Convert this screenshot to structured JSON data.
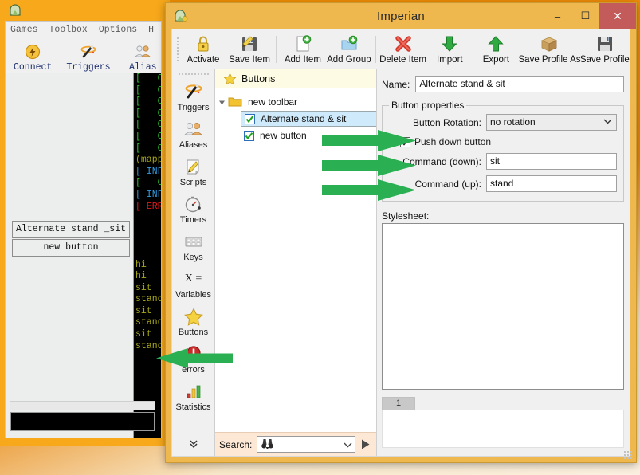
{
  "background_window": {
    "title": "",
    "icon": "mud-client-icon",
    "menu": [
      "Games",
      "Toolbox",
      "Options",
      "H"
    ],
    "toolbar": [
      {
        "label": "Connect",
        "icon": "lightning-bolt-icon"
      },
      {
        "label": "Triggers",
        "icon": "magic-wand-icon"
      },
      {
        "label": "Alias",
        "icon": "people-icon"
      }
    ],
    "buttons_panel": [
      {
        "label": "Alternate stand _sit"
      },
      {
        "label": "new button"
      }
    ],
    "terminal_lines": [
      {
        "text": "[   OK",
        "color": "green"
      },
      {
        "text": "[   OK",
        "color": "green"
      },
      {
        "text": "[   OK",
        "color": "green"
      },
      {
        "text": "[   OK",
        "color": "green"
      },
      {
        "text": "[   OK",
        "color": "green"
      },
      {
        "text": "[   OK",
        "color": "green"
      },
      {
        "text": "[   OK",
        "color": "green"
      },
      {
        "text": "(mappe",
        "color": "olive"
      },
      {
        "text": "[ INFO",
        "color": "blue"
      },
      {
        "text": "[   OK",
        "color": "green"
      },
      {
        "text": "[ INFO",
        "color": "blue"
      },
      {
        "text": "[ ERRO",
        "color": "red"
      },
      {
        "text": "",
        "color": "green"
      },
      {
        "text": "",
        "color": "green"
      },
      {
        "text": "",
        "color": "green"
      },
      {
        "text": "",
        "color": "green"
      },
      {
        "text": "hi",
        "color": "olive"
      },
      {
        "text": "hi",
        "color": "olive"
      },
      {
        "text": "sit",
        "color": "olive"
      },
      {
        "text": "stand",
        "color": "olive"
      },
      {
        "text": "sit",
        "color": "olive"
      },
      {
        "text": "stand",
        "color": "olive"
      },
      {
        "text": "sit",
        "color": "olive"
      },
      {
        "text": "stand",
        "color": "olive"
      }
    ]
  },
  "dialog": {
    "title": "Imperian",
    "app_icon": "imperian-app-icon",
    "window_controls": {
      "minimize": "–",
      "maximize": "☐",
      "close": "✕"
    },
    "toolbar": [
      {
        "label": "Activate",
        "icon": "padlock-icon"
      },
      {
        "label": "Save Item",
        "icon": "save-item-icon"
      },
      {
        "label": "Add Item",
        "icon": "add-item-icon"
      },
      {
        "label": "Add Group",
        "icon": "add-group-icon"
      },
      {
        "label": "Delete Item",
        "icon": "red-x-icon"
      },
      {
        "label": "Import",
        "icon": "import-down-arrow-icon"
      },
      {
        "label": "Export",
        "icon": "export-up-arrow-icon"
      },
      {
        "label": "Save Profile As",
        "icon": "package-box-icon"
      },
      {
        "label": "Save Profile",
        "icon": "floppy-disk-icon"
      }
    ],
    "rail": [
      {
        "label": "Triggers",
        "icon": "magic-wand-icon"
      },
      {
        "label": "Aliases",
        "icon": "people-icon"
      },
      {
        "label": "Scripts",
        "icon": "note-pencil-icon"
      },
      {
        "label": "Timers",
        "icon": "stopwatch-icon"
      },
      {
        "label": "Keys",
        "icon": "keyboard-icon"
      },
      {
        "label": "Variables",
        "icon": "x-equals-icon"
      },
      {
        "label": "Buttons",
        "icon": "yellow-star-icon"
      },
      {
        "label": "errors",
        "icon": "red-error-icon"
      },
      {
        "label": "Statistics",
        "icon": "bar-chart-icon"
      }
    ],
    "rail_expand": "»",
    "tree": {
      "header": {
        "label": "Buttons",
        "icon": "yellow-star-icon"
      },
      "group": {
        "label": "new toolbar",
        "icon": "folder-icon",
        "expanded": true
      },
      "items": [
        {
          "label": "Alternate stand & sit",
          "checked": true,
          "selected": true
        },
        {
          "label": "new button",
          "checked": true,
          "selected": false
        }
      ]
    },
    "search": {
      "label": "Search:",
      "value": "",
      "placeholder": "",
      "icon": "binoculars-icon",
      "dropdown_icon": "chevron-down-icon",
      "go_icon": "play-triangle-icon"
    },
    "properties": {
      "name_label": "Name:",
      "name_value": "Alternate stand & sit",
      "group_legend": "Button properties",
      "rotation_label": "Button Rotation:",
      "rotation_value": "no rotation",
      "pushdown_label": "Push down button",
      "pushdown_checked": true,
      "cmd_down_label": "Command (down):",
      "cmd_down_value": "sit",
      "cmd_up_label": "Command (up):",
      "cmd_up_value": "stand",
      "stylesheet_label": "Stylesheet:",
      "stylesheet_value": "",
      "tab_label": "1"
    }
  },
  "annotations": {
    "arrow_color": "#2aaf52",
    "arrows": [
      {
        "name": "arrow-to-selected-button",
        "direction": "right"
      },
      {
        "name": "arrow-to-new-button",
        "direction": "right"
      },
      {
        "name": "arrow-to-tree-area",
        "direction": "right"
      },
      {
        "name": "arrow-to-terminal-output",
        "direction": "left"
      }
    ]
  }
}
